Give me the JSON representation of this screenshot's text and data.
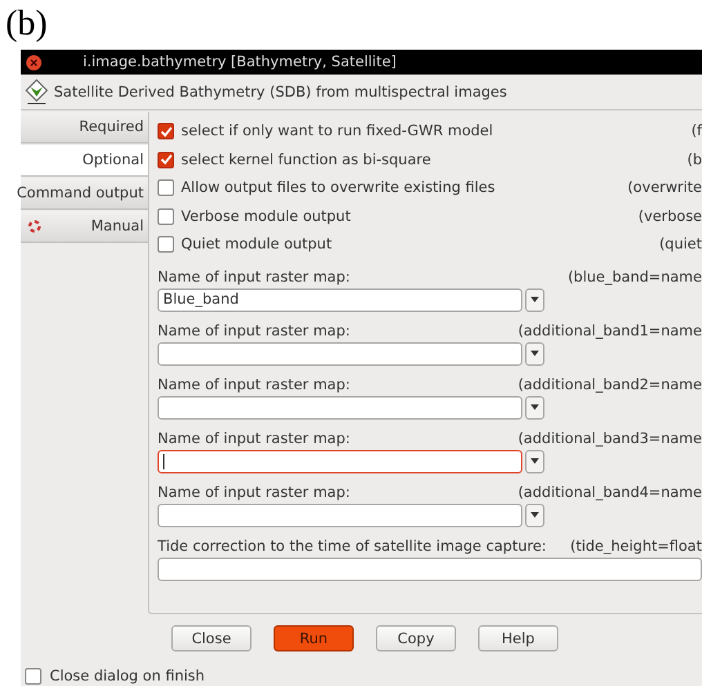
{
  "figure_label": "(b)",
  "window": {
    "title": "i.image.bathymetry [Bathymetry, Satellite]",
    "description": "Satellite Derived Bathymetry (SDB) from multispectral images"
  },
  "tabs": [
    {
      "label": "Required",
      "selected": false,
      "icon": false
    },
    {
      "label": "Optional",
      "selected": true,
      "icon": false
    },
    {
      "label": "Command output",
      "selected": false,
      "icon": false
    },
    {
      "label": "Manual",
      "selected": false,
      "icon": true
    }
  ],
  "options": [
    {
      "label": "select if only want to run fixed-GWR model",
      "flag": "(f",
      "checked": true
    },
    {
      "label": "select kernel function as bi-square",
      "flag": "(b",
      "checked": true
    },
    {
      "label": "Allow output files to overwrite existing files",
      "flag": "(overwrite",
      "checked": false
    },
    {
      "label": "Verbose module output",
      "flag": "(verbose",
      "checked": false
    },
    {
      "label": "Quiet module output",
      "flag": "(quiet",
      "checked": false
    }
  ],
  "inputs": [
    {
      "kind": "combo",
      "label": "Name of input raster map:",
      "param": "(blue_band=name",
      "value": "Blue_band",
      "invalid": false
    },
    {
      "kind": "combo",
      "label": "Name of input raster map:",
      "param": "(additional_band1=name",
      "invalid": false
    },
    {
      "kind": "combo",
      "label": "Name of input raster map:",
      "param": "(additional_band2=name",
      "invalid": false
    },
    {
      "kind": "combo",
      "label": "Name of input raster map:",
      "param": "(additional_band3=name",
      "invalid": true
    },
    {
      "kind": "combo",
      "label": "Name of input raster map:",
      "param": "(additional_band4=name",
      "invalid": false
    },
    {
      "kind": "text",
      "label": "Tide correction to the time of satellite image capture:",
      "param": "(tide_height=float",
      "invalid": false
    }
  ],
  "buttons": [
    {
      "label": "Close",
      "primary": false
    },
    {
      "label": "Run",
      "primary": true
    },
    {
      "label": "Copy",
      "primary": false
    },
    {
      "label": "Help",
      "primary": false
    }
  ],
  "close_on_finish": {
    "label": "Close dialog on finish",
    "checked": false
  }
}
